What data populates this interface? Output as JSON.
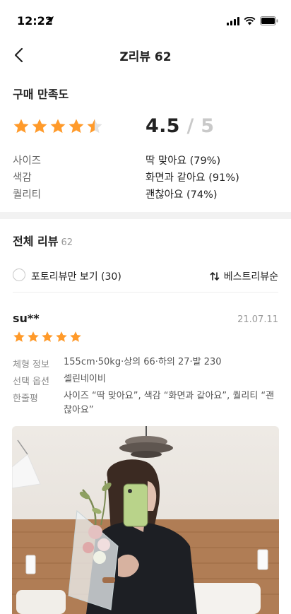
{
  "status_bar": {
    "time": "12:22"
  },
  "nav": {
    "title": "Z리뷰 62"
  },
  "satisfaction": {
    "title": "구매 만족도",
    "score": "4.5",
    "max": "/ 5",
    "stars_value": 4.5,
    "stats": [
      {
        "label": "사이즈",
        "value": "딱 맞아요 (79%)"
      },
      {
        "label": "색감",
        "value": "화면과 같아요 (91%)"
      },
      {
        "label": "퀄리티",
        "value": "괜찮아요 (74%)"
      }
    ]
  },
  "reviews_header": {
    "title": "전체 리뷰",
    "count": "62",
    "photo_only_label": "포토리뷰만 보기 (30)",
    "sort_label": "베스트리뷰순"
  },
  "review": {
    "author": "su**",
    "date": "21.07.11",
    "stars_value": 5,
    "details": [
      {
        "label": "체형 정보",
        "value": "155cm·50kg·상의 66·하의 27·발 230"
      },
      {
        "label": "선택 옵션",
        "value": "셀린네이비"
      },
      {
        "label": "한줄평",
        "value": "사이즈 “딱 맞아요”, 색감 “화면과 같아요”, 퀄리티 “괜찮아요”"
      }
    ]
  },
  "colors": {
    "star": "#FF9A2A",
    "star_empty": "#E1E1E1",
    "divider": "#F2F2F2"
  }
}
